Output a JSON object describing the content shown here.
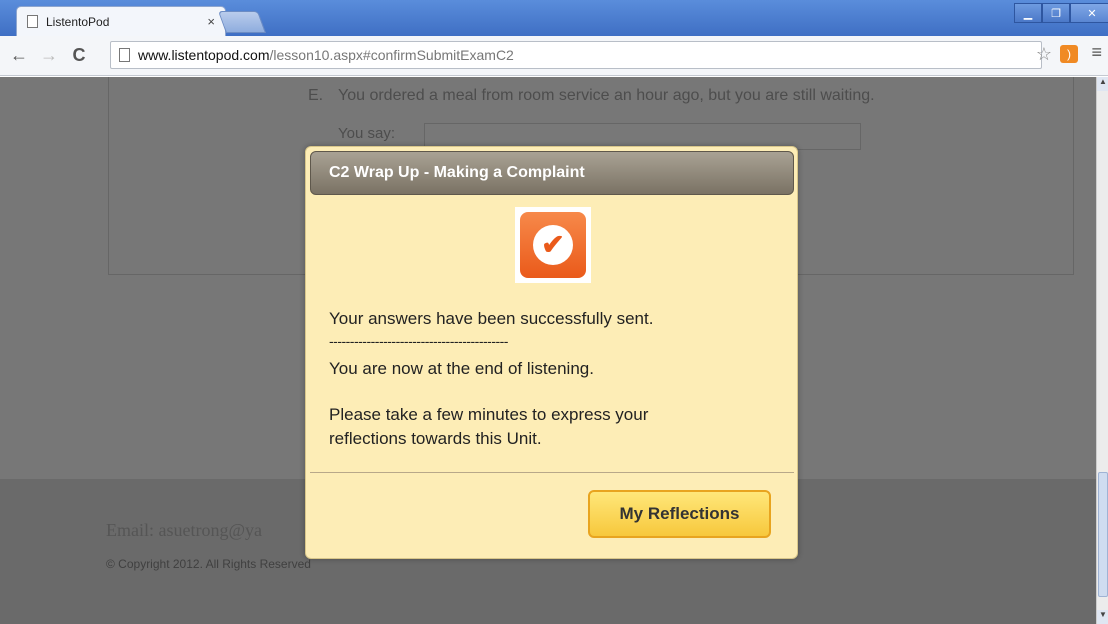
{
  "browser": {
    "tab_title": "ListentoPod",
    "tab_close": "×",
    "url_host": "www.listentopod.com",
    "url_path": "/lesson10.aspx#confirmSubmitExamC2"
  },
  "page": {
    "question_letter": "E.",
    "question_text": "You ordered a meal from room service an hour ago, but you are still waiting.",
    "you_say_label": "You say:",
    "email_text": "Email: asuetrong@ya",
    "copyright": "© Copyright 2012. All Rights Reserved"
  },
  "modal": {
    "title": "C2 Wrap Up - Making a Complaint",
    "line1": "Your answers have been successfully sent.",
    "divider": "-------------------------------------------",
    "line2": "You are now at the end of listening.",
    "line3": "Please take a few minutes to express your",
    "line4": "reflections towards this Unit.",
    "button_label": "My Reflections",
    "icon": "check-icon"
  },
  "colors": {
    "modal_bg": "#fdedb6",
    "header_bg": "#8c8577",
    "button_bg": "#f9d14f",
    "overlay": "#777777",
    "icon_bg": "#ea5a1a"
  }
}
